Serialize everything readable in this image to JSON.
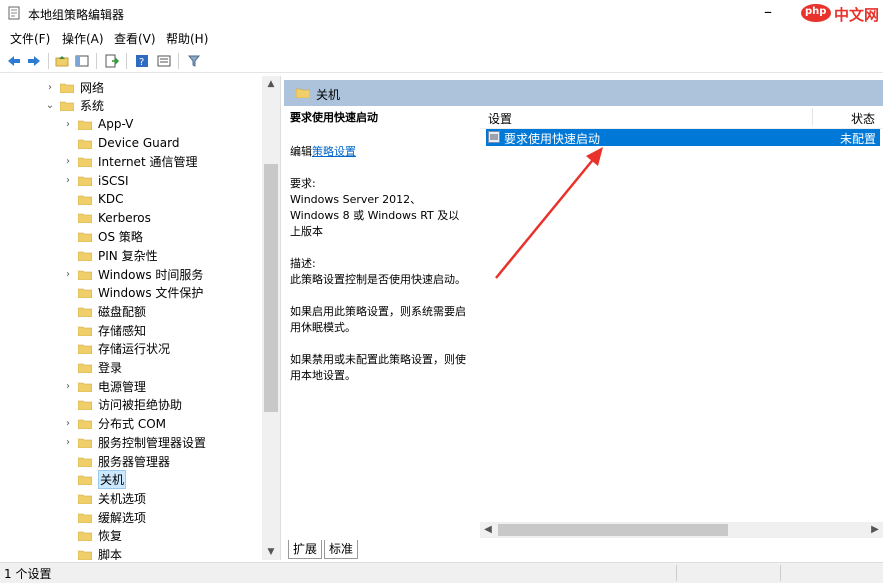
{
  "window": {
    "title": "本地组策略编辑器",
    "watermark_text": "中文网",
    "watermark_badge": "php"
  },
  "menu": [
    "文件(F)",
    "操作(A)",
    "查看(V)",
    "帮助(H)"
  ],
  "tree": {
    "items": [
      {
        "label": "网络",
        "arrow": "›",
        "indent": 0
      },
      {
        "label": "系统",
        "arrow": "⌄",
        "indent": 0
      },
      {
        "label": "App-V",
        "arrow": "›",
        "indent": 1
      },
      {
        "label": "Device Guard",
        "arrow": "",
        "indent": 1
      },
      {
        "label": "Internet 通信管理",
        "arrow": "›",
        "indent": 1
      },
      {
        "label": "iSCSI",
        "arrow": "›",
        "indent": 1
      },
      {
        "label": "KDC",
        "arrow": "",
        "indent": 1
      },
      {
        "label": "Kerberos",
        "arrow": "",
        "indent": 1
      },
      {
        "label": "OS 策略",
        "arrow": "",
        "indent": 1
      },
      {
        "label": "PIN 复杂性",
        "arrow": "",
        "indent": 1
      },
      {
        "label": "Windows 时间服务",
        "arrow": "›",
        "indent": 1
      },
      {
        "label": "Windows 文件保护",
        "arrow": "",
        "indent": 1
      },
      {
        "label": "磁盘配额",
        "arrow": "",
        "indent": 1
      },
      {
        "label": "存储感知",
        "arrow": "",
        "indent": 1
      },
      {
        "label": "存储运行状况",
        "arrow": "",
        "indent": 1
      },
      {
        "label": "登录",
        "arrow": "",
        "indent": 1
      },
      {
        "label": "电源管理",
        "arrow": "›",
        "indent": 1
      },
      {
        "label": "访问被拒绝协助",
        "arrow": "",
        "indent": 1
      },
      {
        "label": "分布式 COM",
        "arrow": "›",
        "indent": 1
      },
      {
        "label": "服务控制管理器设置",
        "arrow": "›",
        "indent": 1
      },
      {
        "label": "服务器管理器",
        "arrow": "",
        "indent": 1
      },
      {
        "label": "关机",
        "arrow": "",
        "indent": 1,
        "selected": true
      },
      {
        "label": "关机选项",
        "arrow": "",
        "indent": 1
      },
      {
        "label": "缓解选项",
        "arrow": "",
        "indent": 1
      },
      {
        "label": "恢复",
        "arrow": "",
        "indent": 1
      },
      {
        "label": "脚本",
        "arrow": "",
        "indent": 1
      }
    ]
  },
  "pane": {
    "header": "关机",
    "desc_title": "要求使用快速启动",
    "edit_prefix": "编辑",
    "edit_link": "策略设置",
    "requirements_label": "要求:",
    "requirements": "Windows Server 2012、Windows 8 或 Windows RT 及以上版本",
    "description_label": "描述:",
    "description": "此策略设置控制是否使用快速启动。",
    "enabled_text": "如果启用此策略设置，则系统需要启用休眠模式。",
    "disabled_text": "如果禁用或未配置此策略设置，则使用本地设置。"
  },
  "list": {
    "col_setting": "设置",
    "col_state": "状态",
    "rows": [
      {
        "name": "要求使用快速启动",
        "state": "未配置"
      }
    ]
  },
  "tabs": [
    "扩展",
    "标准"
  ],
  "status": "1 个设置",
  "colors": {
    "selection": "#0078d7",
    "section_header": "#adc3dc",
    "folder": "#f0cf6a",
    "arrow": "#e8322b"
  }
}
